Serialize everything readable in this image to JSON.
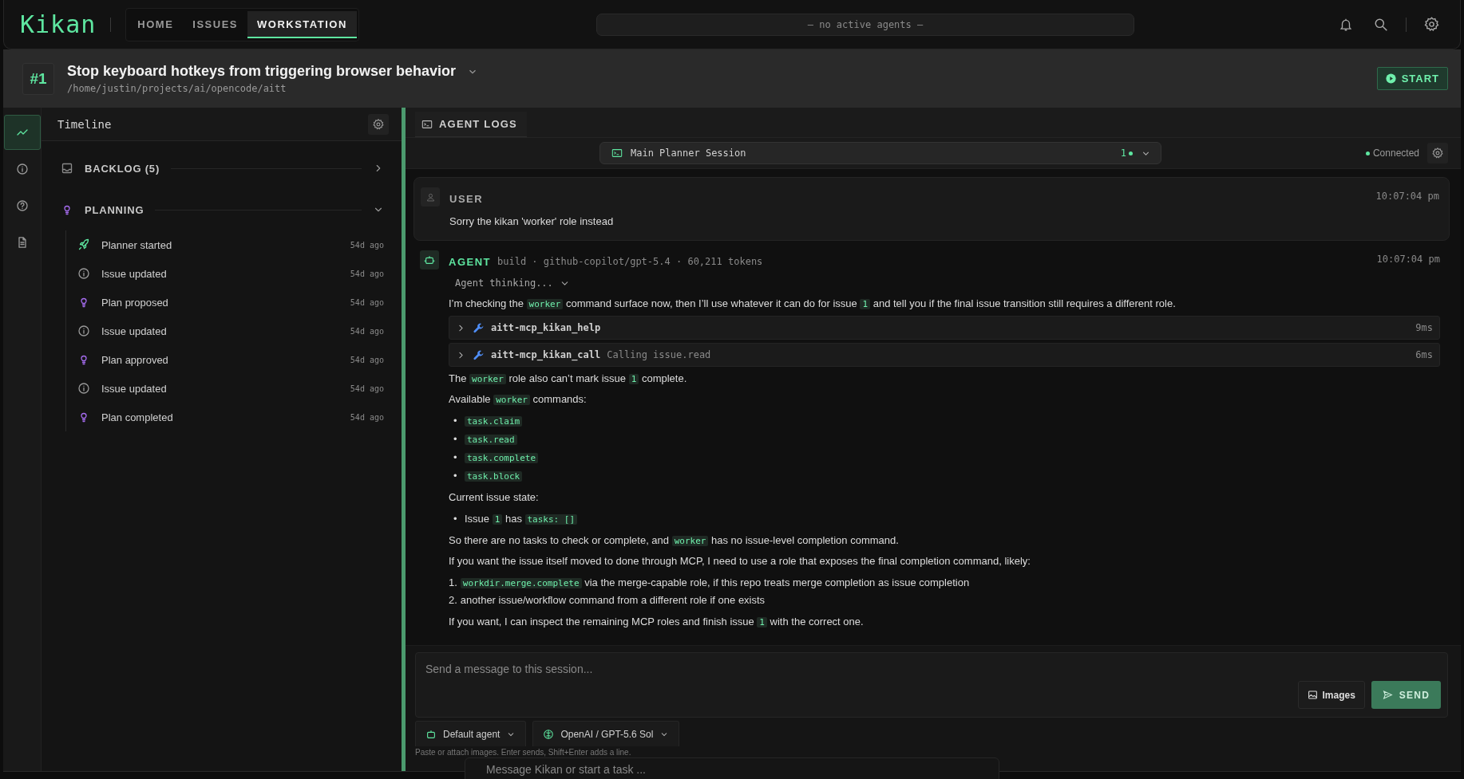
{
  "app": {
    "logo": "Kikan"
  },
  "nav": [
    {
      "label": "HOME",
      "selected": false
    },
    {
      "label": "ISSUES",
      "selected": false
    },
    {
      "label": "WORKSTATION",
      "selected": true
    }
  ],
  "agent_status": "— no active agents —",
  "issue": {
    "number": "#1",
    "title": "Stop keyboard hotkeys from triggering browser behavior",
    "path": "/home/justin/projects/ai/opencode/aitt",
    "start_button": "START"
  },
  "rail": [
    {
      "kind": "activity",
      "selected": true
    },
    {
      "kind": "info",
      "selected": false
    },
    {
      "kind": "help",
      "selected": false
    },
    {
      "kind": "document",
      "selected": false
    }
  ],
  "timeline": {
    "title": "Timeline",
    "sections": [
      {
        "kind": "inbox",
        "label": "BACKLOG (5)",
        "expanded": false
      },
      {
        "kind": "bulb",
        "label": "PLANNING",
        "expanded": true,
        "events": [
          {
            "kind": "rocket",
            "label": "Planner started",
            "time": "54d ago"
          },
          {
            "kind": "info",
            "label": "Issue updated",
            "time": "54d ago"
          },
          {
            "kind": "bulb",
            "label": "Plan proposed",
            "time": "54d ago"
          },
          {
            "kind": "info",
            "label": "Issue updated",
            "time": "54d ago"
          },
          {
            "kind": "bulb",
            "label": "Plan approved",
            "time": "54d ago"
          },
          {
            "kind": "info",
            "label": "Issue updated",
            "time": "54d ago"
          },
          {
            "kind": "bulb",
            "label": "Plan completed",
            "time": "54d ago"
          }
        ]
      }
    ]
  },
  "agent_logs": {
    "tab": "AGENT LOGS",
    "session": {
      "name": "Main Planner Session",
      "count": "1"
    },
    "connection": "Connected",
    "messages": [
      {
        "kind": "user",
        "label": "USER",
        "time": "10:07:04 pm",
        "blocks": [
          {
            "kind": "paragraph",
            "parts": [
              {
                "text": "Sorry the kikan 'worker' role instead",
                "code": false
              }
            ]
          }
        ]
      },
      {
        "kind": "agent",
        "label": "AGENT",
        "meta": "build · github-copilot/gpt-5.4 · 60,211 tokens",
        "time": "10:07:04 pm",
        "blocks": [
          {
            "kind": "thinking",
            "text": "Agent thinking..."
          },
          {
            "kind": "paragraph",
            "parts": [
              {
                "text": "I’m checking the ",
                "code": false
              },
              {
                "text": "worker",
                "code": true
              },
              {
                "text": " command surface now, then I’ll use whatever it can do for issue ",
                "code": false
              },
              {
                "text": "1",
                "code": true
              },
              {
                "text": " and tell you if the final issue transition still requires a different role.",
                "code": false
              }
            ]
          },
          {
            "kind": "tool",
            "name": "aitt-mcp_kikan_help",
            "duration": "9ms"
          },
          {
            "kind": "tool",
            "name": "aitt-mcp_kikan_call",
            "detail": "Calling issue.read",
            "duration": "6ms"
          },
          {
            "kind": "paragraph",
            "parts": [
              {
                "text": "The ",
                "code": false
              },
              {
                "text": "worker",
                "code": true
              },
              {
                "text": " role also can’t mark issue ",
                "code": false
              },
              {
                "text": "1",
                "code": true
              },
              {
                "text": " complete.",
                "code": false
              }
            ]
          },
          {
            "kind": "paragraph",
            "parts": [
              {
                "text": "Available ",
                "code": false
              },
              {
                "text": "worker",
                "code": true
              },
              {
                "text": " commands:",
                "code": false
              }
            ]
          },
          {
            "kind": "bullets",
            "items": [
              {
                "marker": "•",
                "parts": [
                  {
                    "text": "task.claim",
                    "code": true
                  }
                ]
              },
              {
                "marker": "•",
                "parts": [
                  {
                    "text": "task.read",
                    "code": true
                  }
                ]
              },
              {
                "marker": "•",
                "parts": [
                  {
                    "text": "task.complete",
                    "code": true
                  }
                ]
              },
              {
                "marker": "•",
                "parts": [
                  {
                    "text": "task.block",
                    "code": true
                  }
                ]
              }
            ]
          },
          {
            "kind": "paragraph",
            "parts": [
              {
                "text": "Current issue state:",
                "code": false
              }
            ]
          },
          {
            "kind": "bullets",
            "items": [
              {
                "marker": "•",
                "parts": [
                  {
                    "text": "Issue ",
                    "code": false
                  },
                  {
                    "text": "1",
                    "code": true
                  },
                  {
                    "text": " has ",
                    "code": false
                  },
                  {
                    "text": "tasks: []",
                    "code": true
                  }
                ]
              }
            ]
          },
          {
            "kind": "paragraph",
            "parts": [
              {
                "text": "So there are no tasks to check or complete, and ",
                "code": false
              },
              {
                "text": "worker",
                "code": true
              },
              {
                "text": " has no issue-level completion command.",
                "code": false
              }
            ]
          },
          {
            "kind": "paragraph",
            "parts": [
              {
                "text": "If you want the issue itself moved to done through MCP, I need to use a role that exposes the final completion command, likely:",
                "code": false
              }
            ]
          },
          {
            "kind": "numbered",
            "items": [
              {
                "marker": "1.",
                "parts": [
                  {
                    "text": "workdir.merge.complete",
                    "code": true
                  },
                  {
                    "text": " via the merge-capable role, if this repo treats merge completion as issue completion",
                    "code": false
                  }
                ]
              },
              {
                "marker": "2.",
                "parts": [
                  {
                    "text": "another issue/workflow command from a different role if one exists",
                    "code": false
                  }
                ]
              }
            ]
          },
          {
            "kind": "paragraph",
            "parts": [
              {
                "text": "If you want, I can inspect the remaining MCP roles and finish issue ",
                "code": false
              },
              {
                "text": "1",
                "code": true
              },
              {
                "text": " with the correct one.",
                "code": false
              }
            ]
          }
        ]
      }
    ]
  },
  "composer": {
    "placeholder": "Send a message to this session...",
    "images_button": "Images",
    "send_button": "SEND",
    "agent": "Default agent",
    "model": "OpenAI / GPT-5.6 Sol",
    "hint": "Paste or attach images. Enter sends, Shift+Enter adds a line."
  },
  "quick_prompt": {
    "placeholder": "Message Kikan or start a task ..."
  }
}
